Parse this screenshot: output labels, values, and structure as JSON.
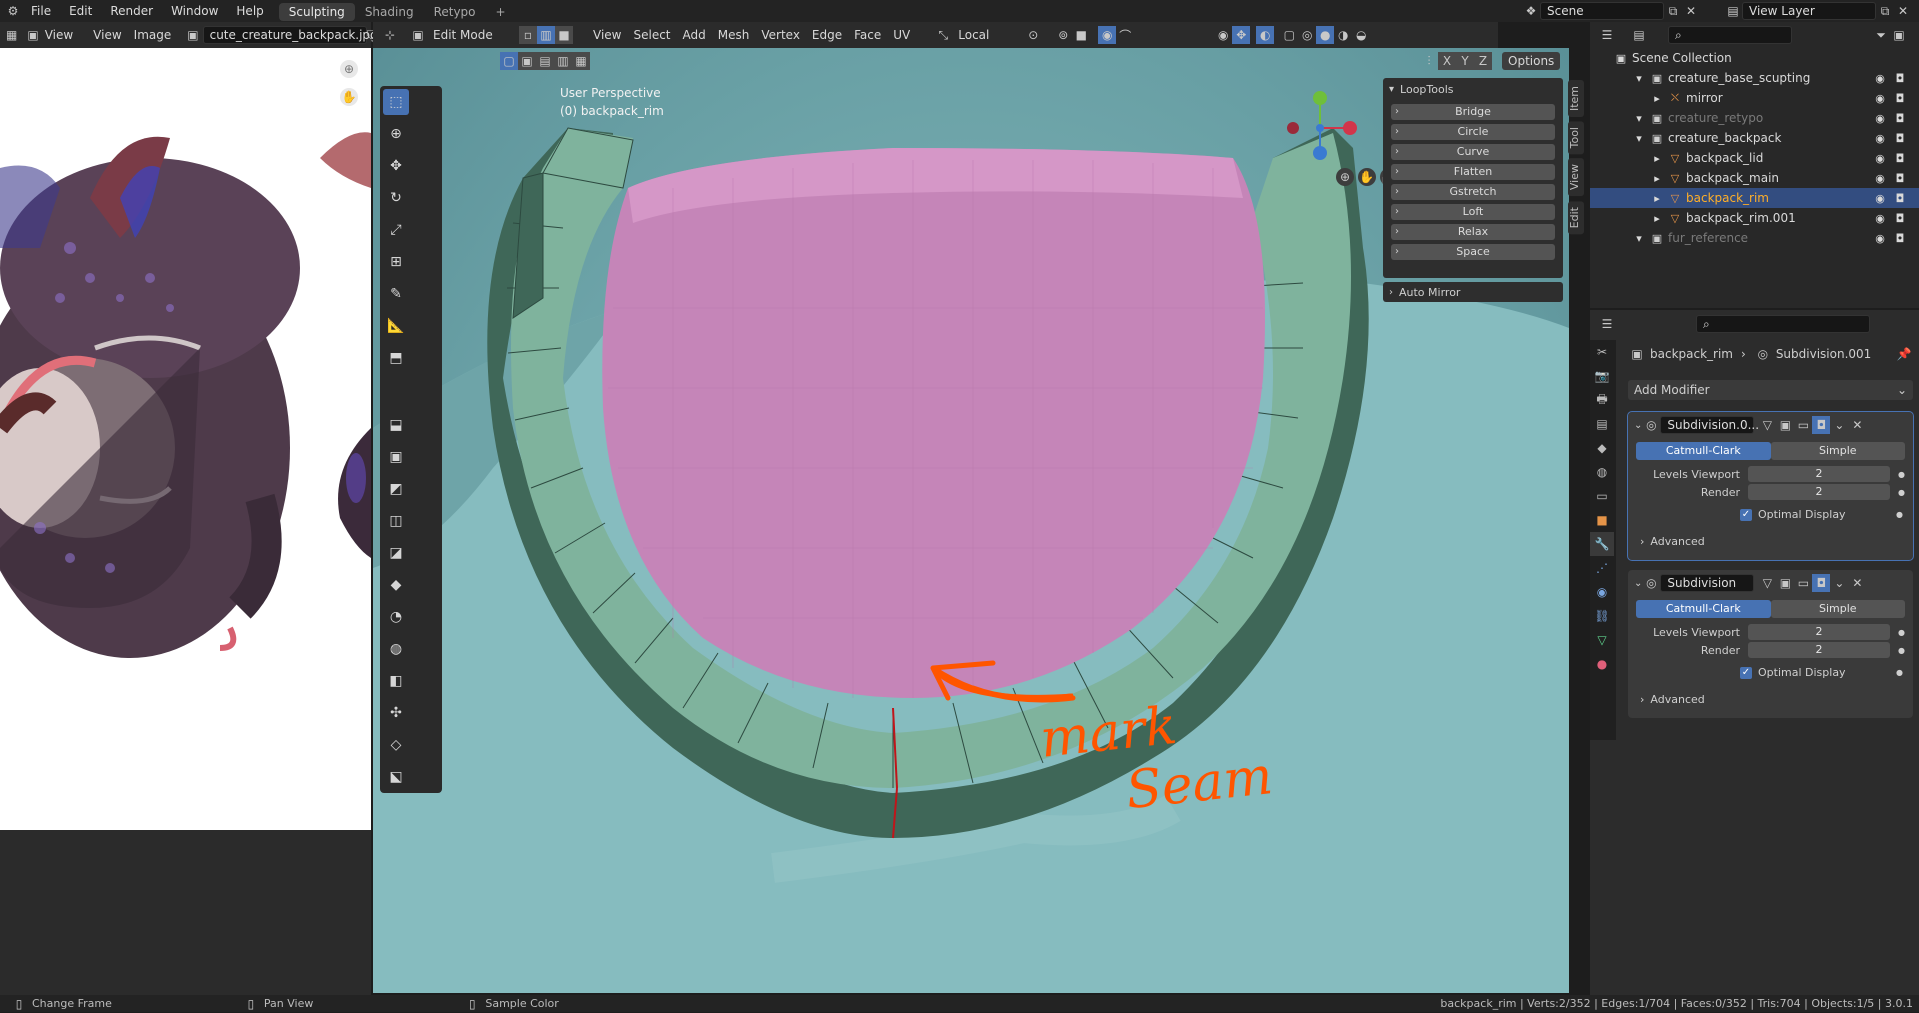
{
  "topbar": {
    "menus": [
      "File",
      "Edit",
      "Render",
      "Window",
      "Help"
    ],
    "workspaces": [
      "Sculpting",
      "Shading",
      "Retypo"
    ],
    "active_workspace": "Sculpting",
    "add_workspace": "+",
    "scene": "Scene",
    "view_layer": "View Layer"
  },
  "image_editor": {
    "view_label": "View",
    "menus": [
      "View",
      "Image"
    ],
    "image_name": "cute_creature_backpack.jpg"
  },
  "viewport": {
    "mode": "Edit Mode",
    "menus": [
      "View",
      "Select",
      "Add",
      "Mesh",
      "Vertex",
      "Edge",
      "Face",
      "UV"
    ],
    "orientation": "Local",
    "axes": [
      "X",
      "Y",
      "Z"
    ],
    "options": "Options",
    "info_line1": "User Perspective",
    "info_line2": "(0) backpack_rim",
    "annotation_text_line1": "mark",
    "annotation_text_line2": "Seam",
    "annotation_color": "#ff5500",
    "seam_color": "#c0151a"
  },
  "looptools": {
    "title": "LoopTools",
    "buttons": [
      "Bridge",
      "Circle",
      "Curve",
      "Flatten",
      "Gstretch",
      "Loft",
      "Relax",
      "Space"
    ],
    "auto_mirror": "Auto Mirror"
  },
  "side_tabs": [
    "Item",
    "Tool",
    "View",
    "Edit"
  ],
  "outliner": {
    "root": "Scene Collection",
    "items": [
      {
        "name": "creature_base_scupting",
        "depth": 1,
        "type": "collection"
      },
      {
        "name": "mirror",
        "depth": 2,
        "type": "armature"
      },
      {
        "name": "creature_retypo",
        "depth": 1,
        "type": "collection-dim"
      },
      {
        "name": "creature_backpack",
        "depth": 1,
        "type": "collection"
      },
      {
        "name": "backpack_lid",
        "depth": 2,
        "type": "mesh"
      },
      {
        "name": "backpack_main",
        "depth": 2,
        "type": "mesh"
      },
      {
        "name": "backpack_rim",
        "depth": 2,
        "type": "mesh-selected"
      },
      {
        "name": "backpack_rim.001",
        "depth": 2,
        "type": "mesh"
      },
      {
        "name": "fur_reference",
        "depth": 1,
        "type": "collection-dim"
      }
    ]
  },
  "properties": {
    "breadcrumb_object": "backpack_rim",
    "breadcrumb_modifier": "Subdivision.001",
    "add_modifier": "Add Modifier",
    "modifiers": [
      {
        "name": "Subdivision.0...",
        "mode_a": "Catmull-Clark",
        "mode_b": "Simple",
        "levels_label": "Levels Viewport",
        "levels": "2",
        "render_label": "Render",
        "render": "2",
        "optimal": "Optimal Display",
        "advanced": "Advanced"
      },
      {
        "name": "Subdivision",
        "mode_a": "Catmull-Clark",
        "mode_b": "Simple",
        "levels_label": "Levels Viewport",
        "levels": "2",
        "render_label": "Render",
        "render": "2",
        "optimal": "Optimal Display",
        "advanced": "Advanced"
      }
    ]
  },
  "statusbar": {
    "hint1": "Change Frame",
    "hint2": "Pan View",
    "hint3": "Sample Color",
    "stats": "backpack_rim | Verts:2/352 | Edges:1/704 | Faces:0/352 | Tris:704 | Objects:1/5 | 3.0.1"
  },
  "colors": {
    "accent": "#4772b3",
    "rim_face": "#7fb39d",
    "rim_side": "#426a5c",
    "pack_body": "#c37fb6",
    "ground": "#86bcbf"
  }
}
